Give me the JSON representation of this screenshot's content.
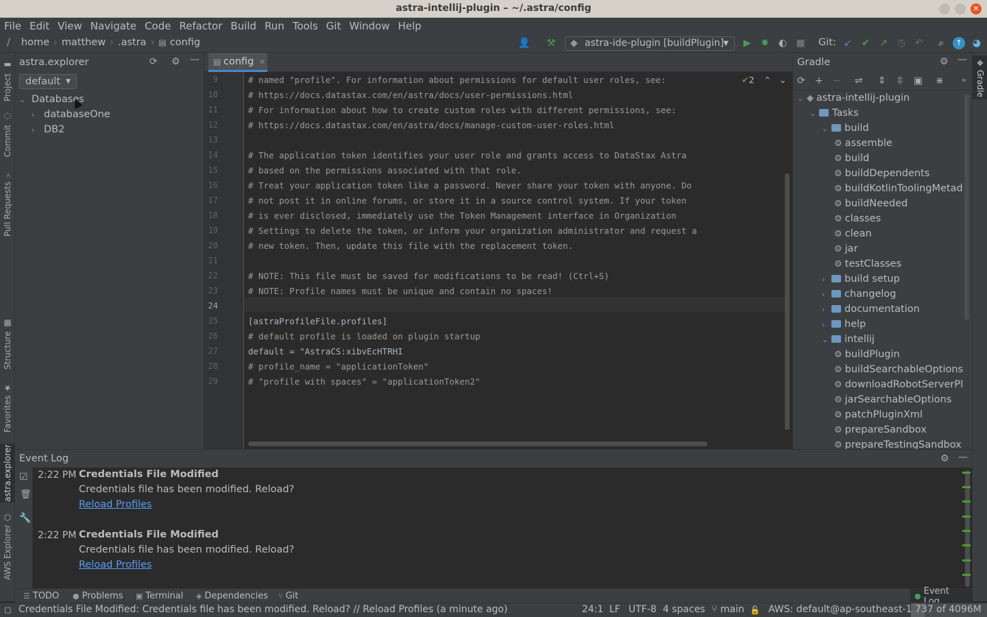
{
  "window": {
    "title": "astra-intellij-plugin – ~/.astra/config"
  },
  "menu": [
    "File",
    "Edit",
    "View",
    "Navigate",
    "Code",
    "Refactor",
    "Build",
    "Run",
    "Tools",
    "Git",
    "Window",
    "Help"
  ],
  "breadcrumbs": [
    "home",
    "matthew",
    ".astra",
    "config"
  ],
  "toolbar": {
    "run_config": "astra-ide-plugin [buildPlugin]",
    "git_label": "Git:"
  },
  "left_strip": [
    "Project",
    "Commit",
    "Pull Requests",
    "Structure",
    "Favorites",
    "astra.explorer",
    "AWS Explorer"
  ],
  "project_panel": {
    "title": "astra.explorer",
    "profile": "default",
    "tree": {
      "root": "Databases",
      "children": [
        "databaseOne",
        "DB2"
      ]
    }
  },
  "editor": {
    "tab": "config",
    "inspection_count": "2",
    "lines": [
      {
        "n": "9",
        "text": "# named \"profile\". For information about permissions for default user roles, see:",
        "type": "comment"
      },
      {
        "n": "10",
        "text": "# https://docs.datastax.com/en/astra/docs/user-permissions.html",
        "type": "comment"
      },
      {
        "n": "11",
        "text": "# For information about how to create custom roles with different permissions, see:",
        "type": "comment"
      },
      {
        "n": "12",
        "text": "# https://docs.datastax.com/en/astra/docs/manage-custom-user-roles.html",
        "type": "comment"
      },
      {
        "n": "13",
        "text": "",
        "type": "comment"
      },
      {
        "n": "14",
        "text": "# The application token identifies your user role and grants access to DataStax Astra",
        "type": "comment"
      },
      {
        "n": "15",
        "text": "# based on the permissions associated with that role.",
        "type": "comment"
      },
      {
        "n": "16",
        "text": "# Treat your application token like a password. Never share your token with anyone. Do",
        "type": "comment"
      },
      {
        "n": "17",
        "text": "# not post it in online forums, or store it in a source control system. If your token",
        "type": "comment"
      },
      {
        "n": "18",
        "text": "# is ever disclosed, immediately use the Token Management interface in Organization",
        "type": "comment"
      },
      {
        "n": "19",
        "text": "# Settings to delete the token, or inform your organization administrator and request a",
        "type": "comment"
      },
      {
        "n": "20",
        "text": "# new token. Then, update this file with the replacement token.",
        "type": "comment"
      },
      {
        "n": "21",
        "text": "",
        "type": "comment"
      },
      {
        "n": "22",
        "text": "# NOTE: This file must be saved for modifications to be read! (Ctrl+S)",
        "type": "comment"
      },
      {
        "n": "23",
        "text": "# NOTE: Profile names must be unique and contain no spaces!",
        "type": "comment"
      },
      {
        "n": "24",
        "text": "",
        "type": "code"
      },
      {
        "n": "25",
        "text": "[astraProfileFile.profiles]",
        "type": "code"
      },
      {
        "n": "26",
        "text": "# default profile is loaded on plugin startup",
        "type": "comment"
      },
      {
        "n": "27",
        "text": "default = \"AstraCS:xibvEcHTRHI",
        "type": "code"
      },
      {
        "n": "28",
        "text": "# profile_name = \"applicationToken\"",
        "type": "comment"
      },
      {
        "n": "29",
        "text": "# \"profile with spaces\" = \"applicationToken2\"",
        "type": "comment"
      }
    ]
  },
  "gradle": {
    "title": "Gradle",
    "tree": [
      {
        "label": "astra-intellij-plugin",
        "kind": "project",
        "open": true,
        "depth": 0
      },
      {
        "label": "Tasks",
        "kind": "folder",
        "open": true,
        "depth": 1
      },
      {
        "label": "build",
        "kind": "group",
        "open": true,
        "depth": 2
      },
      {
        "label": "assemble",
        "kind": "task",
        "depth": 3
      },
      {
        "label": "build",
        "kind": "task",
        "depth": 3
      },
      {
        "label": "buildDependents",
        "kind": "task",
        "depth": 3
      },
      {
        "label": "buildKotlinToolingMetad",
        "kind": "task",
        "depth": 3
      },
      {
        "label": "buildNeeded",
        "kind": "task",
        "depth": 3
      },
      {
        "label": "classes",
        "kind": "task",
        "depth": 3
      },
      {
        "label": "clean",
        "kind": "task",
        "depth": 3
      },
      {
        "label": "jar",
        "kind": "task",
        "depth": 3
      },
      {
        "label": "testClasses",
        "kind": "task",
        "depth": 3
      },
      {
        "label": "build setup",
        "kind": "group",
        "open": false,
        "depth": 2
      },
      {
        "label": "changelog",
        "kind": "group",
        "open": false,
        "depth": 2
      },
      {
        "label": "documentation",
        "kind": "group",
        "open": false,
        "depth": 2
      },
      {
        "label": "help",
        "kind": "group",
        "open": false,
        "depth": 2
      },
      {
        "label": "intellij",
        "kind": "group",
        "open": true,
        "depth": 2
      },
      {
        "label": "buildPlugin",
        "kind": "task",
        "depth": 3
      },
      {
        "label": "buildSearchableOptions",
        "kind": "task",
        "depth": 3
      },
      {
        "label": "downloadRobotServerPl",
        "kind": "task",
        "depth": 3
      },
      {
        "label": "jarSearchableOptions",
        "kind": "task",
        "depth": 3
      },
      {
        "label": "patchPluginXml",
        "kind": "task",
        "depth": 3
      },
      {
        "label": "prepareSandbox",
        "kind": "task",
        "depth": 3
      },
      {
        "label": "prepareTestingSandbox",
        "kind": "task",
        "depth": 3
      }
    ]
  },
  "right_strip": [
    "Gradle"
  ],
  "event_log": {
    "title": "Event Log",
    "entries": [
      {
        "time": "2:22 PM",
        "title": "Credentials File Modified",
        "message": "Credentials file has been modified. Reload?",
        "link": "Reload Profiles"
      },
      {
        "time": "2:22 PM",
        "title": "Credentials File Modified",
        "message": "Credentials file has been modified. Reload?",
        "link": "Reload Profiles"
      }
    ]
  },
  "bottom_tabs": [
    "TODO",
    "Problems",
    "Terminal",
    "Dependencies",
    "Git",
    "Event Log"
  ],
  "status": {
    "message": "Credentials File Modified: Credentials file has been modified. Reload? // Reload Profiles (a minute ago)",
    "position": "24:1",
    "line_sep": "LF",
    "encoding": "UTF-8",
    "indent": "4 spaces",
    "branch": "main",
    "aws": "AWS: default@ap-southeast-1",
    "memory": "737 of 4096M",
    "memory_fraction": 0.18
  },
  "colors": {
    "accent": "#4a88c7",
    "link": "#589df6",
    "run_green": "#499c54"
  }
}
